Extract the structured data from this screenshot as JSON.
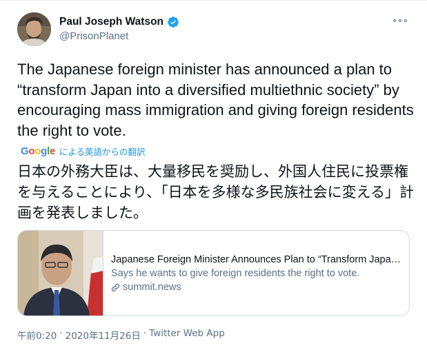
{
  "author": {
    "display_name": "Paul Joseph Watson",
    "handle": "@PrisonPlanet",
    "verified": true
  },
  "tweet": {
    "text": "The Japanese foreign minister has announced a plan to “transform Japan into a diversified multiethnic society” by encouraging mass immigration and giving foreign residents the right to vote.",
    "translate_label": "による英語からの翻訳",
    "translated_text": "日本の外務大臣は、大量移民を奨励し、外国人住民に投票権を与えることにより、「日本を多様な多民族社会に変える」計画を発表しました。"
  },
  "card": {
    "title": "Japanese Foreign Minister Announces Plan to “Transform Japa…",
    "description": "Says he wants to give foreign residents the right to vote.",
    "domain": "summit.news"
  },
  "meta": {
    "time": "午前0:20",
    "separator": "·",
    "date": "2020年11月26日",
    "source": "Twitter Web App"
  },
  "colors": {
    "link_blue": "#1b95e0",
    "verified_blue": "#1da1f2",
    "secondary_text": "#5b7083",
    "border": "#cfd9de"
  },
  "icons": [
    "avatar",
    "verified-badge-icon",
    "more-options-icon",
    "google-logo",
    "link-icon"
  ]
}
